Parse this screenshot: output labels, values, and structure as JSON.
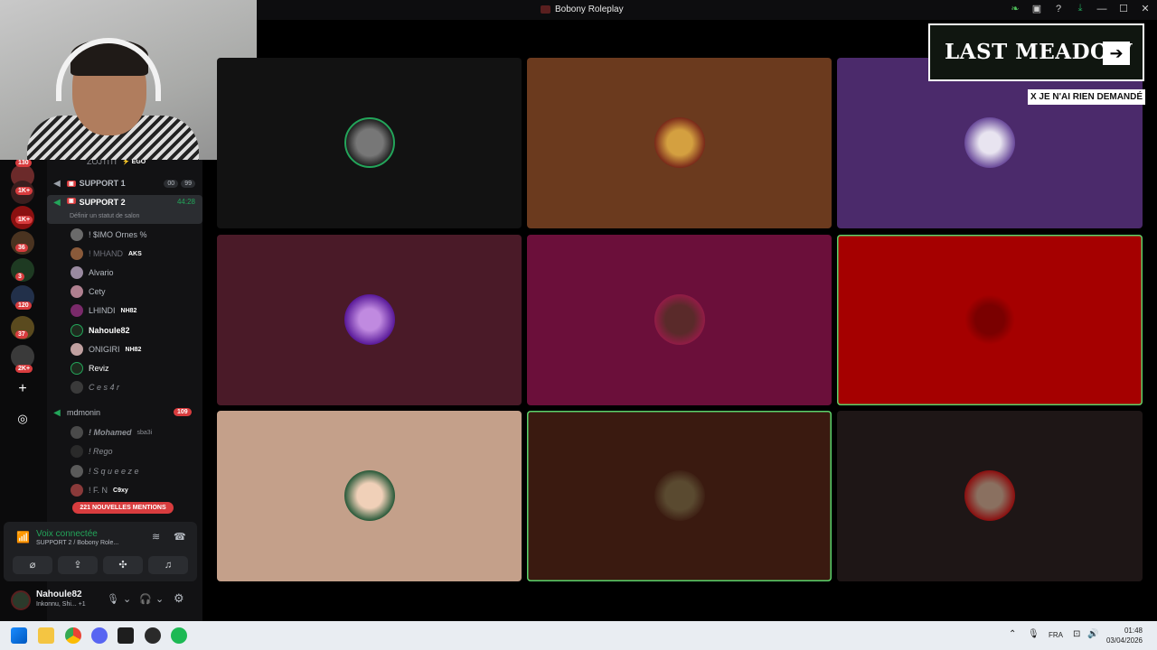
{
  "window": {
    "title": "Bobony Roleplay"
  },
  "titlebar_icons": [
    "leaf-icon",
    "screen-icon",
    "help-icon",
    "download-icon",
    "minimize-icon",
    "maximize-icon",
    "close-icon"
  ],
  "titlebar_glyphs": {
    "leaf": "❧",
    "screen": "▣",
    "help": "?",
    "download": "⤓",
    "minimize": "—",
    "maximize": "☐",
    "close": "✕"
  },
  "rail": {
    "badges": [
      "130",
      "1K+",
      "1K+",
      "36",
      "3",
      "120",
      "37",
      "2K+"
    ],
    "add_glyph": "+",
    "discover_glyph": "◎"
  },
  "channels": {
    "top_partial": "ZOJTITI",
    "top_partial_tag": "⚡ EGO",
    "support1": {
      "label": "SUPPORT 1",
      "pill_a": "00",
      "pill_b": "99"
    },
    "support2": {
      "label": "SUPPORT 2",
      "timer": "44:28",
      "status": "Définir un statut de salon"
    },
    "members": [
      {
        "name": "! $IMO Ornes %",
        "tag": ""
      },
      {
        "name": "! MHAND",
        "tag": "AKS"
      },
      {
        "name": "Alvario",
        "tag": ""
      },
      {
        "name": "Cety",
        "tag": ""
      },
      {
        "name": "LHINDI",
        "tag": "NH82"
      },
      {
        "name": "Nahoule82",
        "tag": ""
      },
      {
        "name": "ONIGIRI",
        "tag": "NH82"
      },
      {
        "name": "Reviz",
        "tag": ""
      },
      {
        "name": "C e s 4 r",
        "tag": ""
      }
    ],
    "mdmonin": {
      "label": "mdmonin",
      "count": "109"
    },
    "mdmonin_members": [
      {
        "name": "! Mohamed",
        "tag": "sba3i"
      },
      {
        "name": "! Rego",
        "tag": ""
      },
      {
        "name": "! S q u e e z e",
        "tag": ""
      },
      {
        "name": "! F. N",
        "tag": "C9xy"
      }
    ],
    "mentions": "221 NOUVELLES MENTIONS"
  },
  "voice": {
    "status": "Voix connectée",
    "channel": "SUPPORT 2 / Bobony Role...",
    "buttons": [
      "camera-off",
      "screen-share",
      "activities",
      "soundboard"
    ],
    "button_glyphs": [
      "⌀",
      "⇪",
      "✣",
      "♫"
    ]
  },
  "user": {
    "name": "Nahoule82",
    "status": "Inkonnu, Shi... +1"
  },
  "user_glyphs": {
    "mic": "🎙",
    "headset": "🎧",
    "settings": "⚙",
    "chevron": "⌄"
  },
  "overlay": {
    "brand": "LAST MEADOW",
    "arrow": "➔",
    "caption": "X JE N'AI RIEN DEMANDÉ"
  },
  "tiles": {
    "colors": [
      "#121212",
      "#6b3a1e",
      "#4b2a6b",
      "#4a1a28",
      "#6b0f3a",
      "#a50000",
      "#c4a08a",
      "#3a1a10",
      "#1e1616"
    ]
  },
  "taskbar": {
    "language": "FRA",
    "time": "01:48",
    "date": "03/04/2026",
    "tray_glyphs": {
      "chevron": "⌃",
      "mic": "🎙",
      "network": "⊡",
      "volume": "🔊"
    }
  }
}
